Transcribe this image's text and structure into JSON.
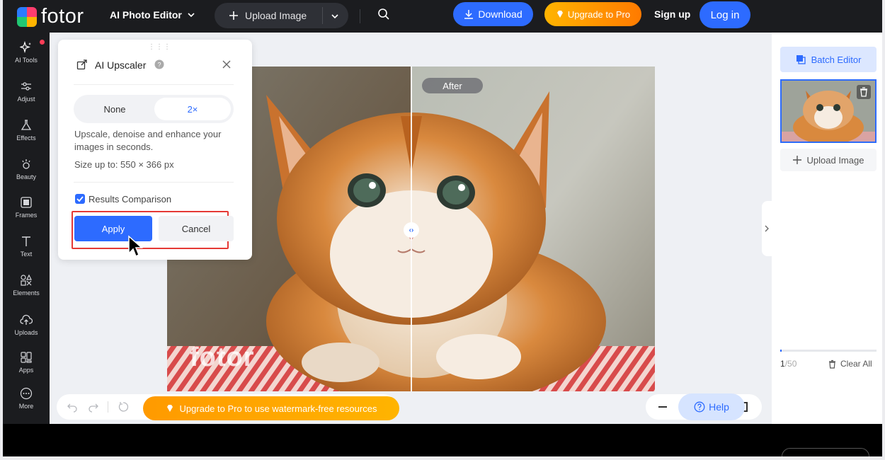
{
  "colors": {
    "accent": "#2d6bff",
    "topbar": "#1b1c1f",
    "pro_gradient_start": "#ffb400",
    "pro_gradient_end": "#ff7a00",
    "highlight_border": "#e53935"
  },
  "header": {
    "logo_text": "fotor",
    "editor_menu": "AI Photo Editor",
    "upload_label": "Upload Image",
    "download_label": "Download",
    "upgrade_label": "Upgrade to Pro",
    "signup_label": "Sign up",
    "login_label": "Log in"
  },
  "sidebar": {
    "items": [
      {
        "label": "AI Tools",
        "icon": "sparkle-icon"
      },
      {
        "label": "Adjust",
        "icon": "sliders-icon"
      },
      {
        "label": "Effects",
        "icon": "flask-icon"
      },
      {
        "label": "Beauty",
        "icon": "eye-icon"
      },
      {
        "label": "Frames",
        "icon": "frame-icon"
      },
      {
        "label": "Text",
        "icon": "text-icon"
      },
      {
        "label": "Elements",
        "icon": "shapes-icon"
      },
      {
        "label": "Uploads",
        "icon": "cloud-upload-icon"
      },
      {
        "label": "Apps",
        "icon": "apps-icon"
      },
      {
        "label": "More",
        "icon": "more-icon"
      }
    ]
  },
  "panel": {
    "title": "AI Upscaler",
    "options": [
      "None",
      "2×"
    ],
    "selected_option": "2×",
    "description": "Upscale, denoise and enhance your images in seconds.",
    "size_text": "Size up to: 550 × 366 px",
    "comparison_label": "Results Comparison",
    "comparison_checked": true,
    "apply_label": "Apply",
    "cancel_label": "Cancel"
  },
  "canvas": {
    "after_label": "After",
    "watermark": "fotor"
  },
  "bottombar": {
    "upgrade_text": "Upgrade to Pro to use watermark-free resources",
    "help_label": "Help"
  },
  "rightpanel": {
    "batch_label": "Batch Editor",
    "upload_label": "Upload Image",
    "count_current": "1",
    "count_total": "/50",
    "clear_label": "Clear All"
  }
}
